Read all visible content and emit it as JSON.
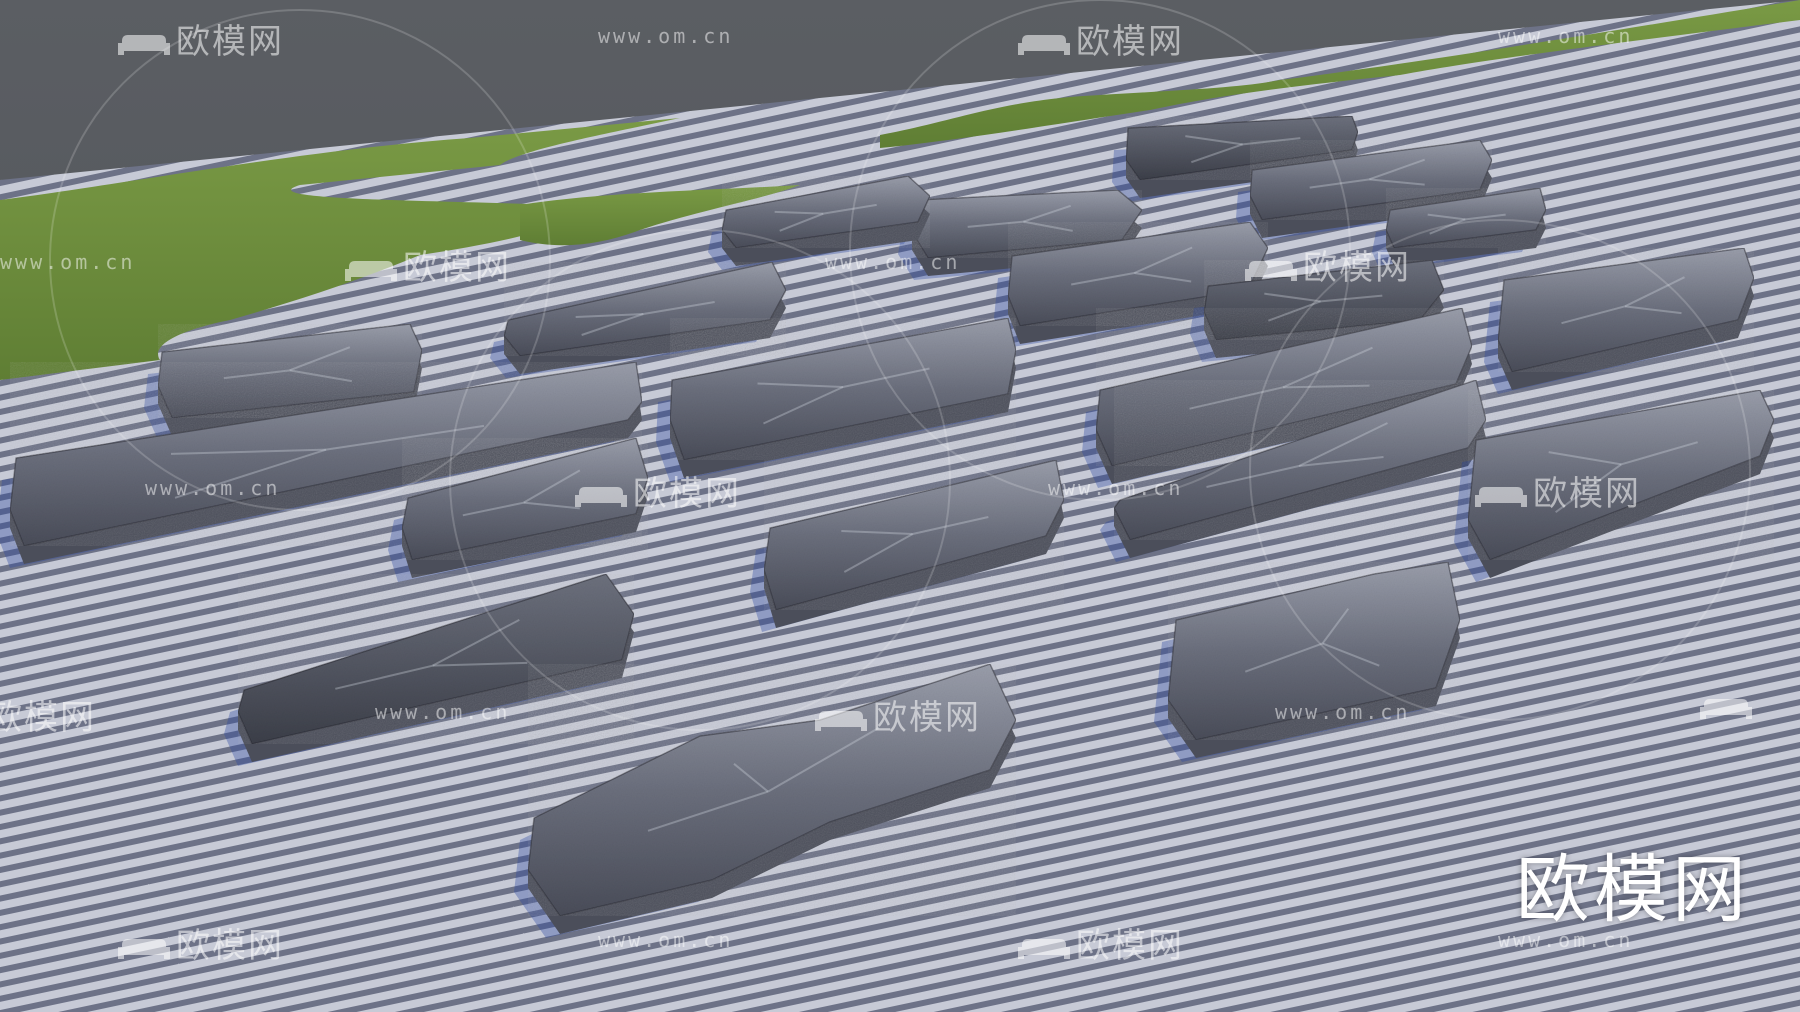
{
  "scene": {
    "subject": "rendered landscape stones on striped gravel with grass islands"
  },
  "watermark": {
    "logo_text": "欧模网",
    "url_text": "www.om.cn"
  },
  "brand_mark": {
    "text": "欧模网"
  },
  "colors": {
    "sky": "#54575c",
    "gravel_light": "#c9ccd8",
    "gravel_dark": "#6f7488",
    "grass": "#6f8f3e",
    "stone_base": "#777b88",
    "stone_dark": "#4a4d57"
  }
}
